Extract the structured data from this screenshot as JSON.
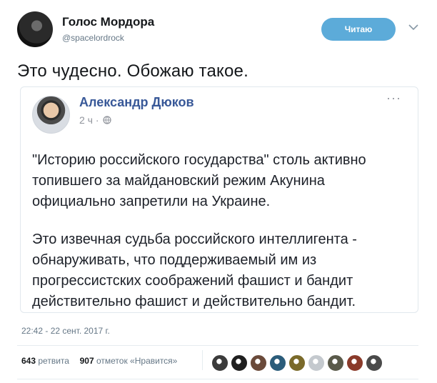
{
  "header": {
    "name": "Голос Мордора",
    "handle": "@spacelordrock",
    "follow_label": "Читаю"
  },
  "tweet_text": "Это чудесно. Обожаю такое.",
  "embedded_post": {
    "author": "Александр Дюков",
    "time": "2 ч",
    "dot": "·",
    "more": "···",
    "paragraphs": [
      "\"Историю российского государства\" столь активно топившего за майдановский режим Акунина официально запретили на Украине.",
      "Это извечная судьба российского интеллигента - обнаруживать, что поддерживаемый им из прогрессистских соображений фашист и бандит действительно фашист и действительно бандит."
    ]
  },
  "timestamp": "22:42 - 22 сент. 2017 г.",
  "stats": {
    "retweets_count": "643",
    "retweets_label": "ретвита",
    "likes_count": "907",
    "likes_label": "отметок «Нравится»"
  },
  "colors": {
    "follow_button": "#5cabd9",
    "fb_link": "#385898",
    "muted": "#657786"
  },
  "liker_avatars": [
    "#3b3b3b",
    "#1f1f1f",
    "#6a4a3a",
    "#2b5c7a",
    "#7a6a2a",
    "#c4c9ce",
    "#5a5a4a",
    "#8a3a2a",
    "#4a4a4a"
  ]
}
